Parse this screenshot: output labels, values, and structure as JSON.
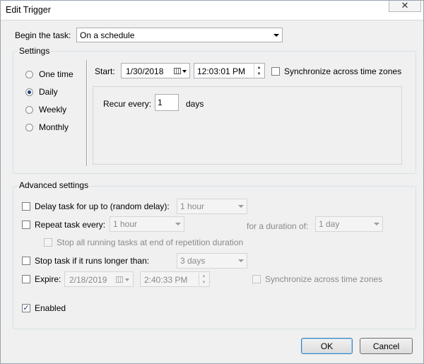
{
  "window": {
    "title": "Edit Trigger",
    "close_glyph": "✕"
  },
  "begin_task": {
    "label": "Begin the task:",
    "value": "On a schedule"
  },
  "settings": {
    "group_label": "Settings",
    "schedule_options": [
      {
        "label": "One time",
        "selected": false
      },
      {
        "label": "Daily",
        "selected": true
      },
      {
        "label": "Weekly",
        "selected": false
      },
      {
        "label": "Monthly",
        "selected": false
      }
    ],
    "start_label": "Start:",
    "start_date": "1/30/2018",
    "start_time": "12:03:01 PM",
    "sync_time_zones": {
      "label": "Synchronize across time zones",
      "checked": false
    },
    "recur_label": "Recur every:",
    "recur_value": "1",
    "recur_unit": "days"
  },
  "advanced": {
    "group_label": "Advanced settings",
    "delay": {
      "label": "Delay task for up to (random delay):",
      "checked": false,
      "value": "1 hour"
    },
    "repeat": {
      "label": "Repeat task every:",
      "checked": false,
      "value": "1 hour",
      "duration_label": "for a duration of:",
      "duration_value": "1 day"
    },
    "stop_running": {
      "label": "Stop all running tasks at end of repetition duration",
      "checked": false
    },
    "stop_longer": {
      "label": "Stop task if it runs longer than:",
      "checked": false,
      "value": "3 days"
    },
    "expire": {
      "label": "Expire:",
      "checked": false,
      "date": "2/18/2019",
      "time": "2:40:33 PM",
      "sync_label": "Synchronize across time zones"
    },
    "enabled": {
      "label": "Enabled",
      "checked": true,
      "mark": "✓"
    }
  },
  "buttons": {
    "ok": "OK",
    "cancel": "Cancel"
  }
}
